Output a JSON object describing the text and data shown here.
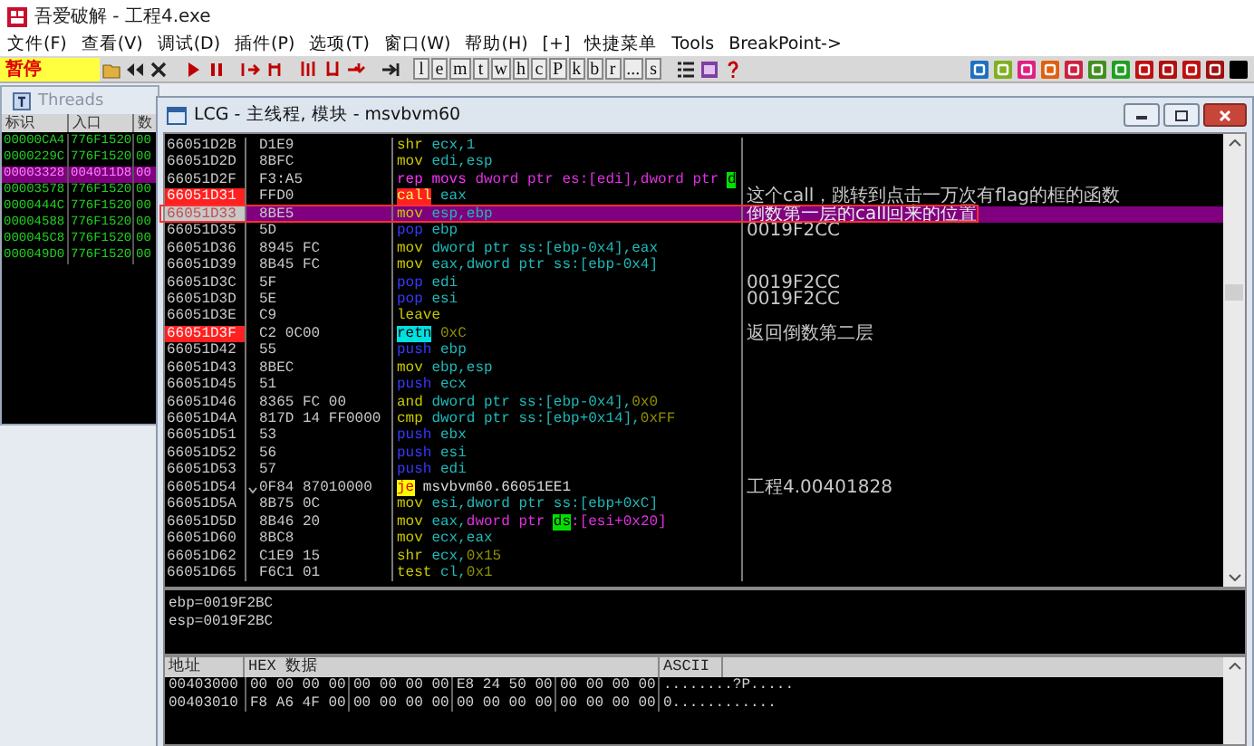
{
  "window": {
    "title": "吾爱破解 - 工程4.exe"
  },
  "menu": [
    "文件(F)",
    "查看(V)",
    "调试(D)",
    "插件(P)",
    "选项(T)",
    "窗口(W)",
    "帮助(H)",
    "[+]",
    "快捷菜单",
    "Tools",
    "BreakPoint->"
  ],
  "toolbar": {
    "status": "暂停",
    "letters": [
      "l",
      "e",
      "m",
      "t",
      "w",
      "h",
      "c",
      "P",
      "k",
      "b",
      "r",
      "...",
      "s"
    ]
  },
  "threads_window": {
    "title": "Threads",
    "columns": [
      "标识",
      "入口",
      "数"
    ],
    "rows": [
      {
        "cells": [
          "00000CA4",
          "776F1520",
          "00"
        ],
        "selected": false
      },
      {
        "cells": [
          "0000229C",
          "776F1520",
          "00"
        ],
        "selected": false
      },
      {
        "cells": [
          "00003328",
          "004011D8",
          "00"
        ],
        "selected": true
      },
      {
        "cells": [
          "00003578",
          "776F1520",
          "00"
        ],
        "selected": false
      },
      {
        "cells": [
          "0000444C",
          "776F1520",
          "00"
        ],
        "selected": false
      },
      {
        "cells": [
          "00004588",
          "776F1520",
          "00"
        ],
        "selected": false
      },
      {
        "cells": [
          "000045C8",
          "776F1520",
          "00"
        ],
        "selected": false
      },
      {
        "cells": [
          "000049D0",
          "776F1520",
          "00"
        ],
        "selected": false
      }
    ]
  },
  "cpu_window": {
    "title": "LCG - 主线程, 模块 - msvbvm60",
    "rows": [
      {
        "address": "66051D2B",
        "hex": "D1E9",
        "mnemonic": "shr",
        "kind": "plain",
        "operands": [
          {
            "text": "ecx,1",
            "kind": "reg"
          }
        ],
        "breakpoint": false,
        "selected": false
      },
      {
        "address": "66051D2D",
        "hex": "8BFC",
        "mnemonic": "mov",
        "kind": "plain",
        "operands": [
          {
            "text": "edi,esp",
            "kind": "reg"
          }
        ],
        "breakpoint": false,
        "selected": false
      },
      {
        "address": "66051D2F",
        "hex": "F3:A5",
        "mnemonic": "rep movs",
        "kind": "string",
        "operands": [
          {
            "text": "dword ptr es:[edi],dword ptr ",
            "kind": "string"
          },
          {
            "text": "d",
            "kind": "segment"
          }
        ],
        "breakpoint": false,
        "selected": false
      },
      {
        "address": "66051D31",
        "hex": "FFD0",
        "mnemonic": "call",
        "kind": "call",
        "operands": [
          {
            "text": "eax",
            "kind": "reg"
          }
        ],
        "comment": "这个call，跳转到点击一万次有flag的框的函数",
        "breakpoint": true,
        "selected": false
      },
      {
        "address": "66051D33",
        "hex": "8BE5",
        "mnemonic": "mov",
        "kind": "plain",
        "operands": [
          {
            "text": "esp,ebp",
            "kind": "reg"
          }
        ],
        "comment": "倒数第一层的call回来的位置",
        "breakpoint": false,
        "selected": true,
        "boxed": true
      },
      {
        "address": "66051D35",
        "hex": "5D",
        "mnemonic": "pop",
        "kind": "stack",
        "operands": [
          {
            "text": "ebp",
            "kind": "reg"
          }
        ],
        "comment": "0019F2CC",
        "breakpoint": false,
        "selected": false
      },
      {
        "address": "66051D36",
        "hex": "8945 FC",
        "mnemonic": "mov",
        "kind": "plain",
        "operands": [
          {
            "text": "dword ptr ss:[ebp-0x4],eax",
            "kind": "reg"
          }
        ],
        "breakpoint": false,
        "selected": false
      },
      {
        "address": "66051D39",
        "hex": "8B45 FC",
        "mnemonic": "mov",
        "kind": "plain",
        "operands": [
          {
            "text": "eax,dword ptr ss:[ebp-0x4]",
            "kind": "reg"
          }
        ],
        "breakpoint": false,
        "selected": false
      },
      {
        "address": "66051D3C",
        "hex": "5F",
        "mnemonic": "pop",
        "kind": "stack",
        "operands": [
          {
            "text": "edi",
            "kind": "reg"
          }
        ],
        "comment": "0019F2CC",
        "breakpoint": false,
        "selected": false
      },
      {
        "address": "66051D3D",
        "hex": "5E",
        "mnemonic": "pop",
        "kind": "stack",
        "operands": [
          {
            "text": "esi",
            "kind": "reg"
          }
        ],
        "comment": "0019F2CC",
        "breakpoint": false,
        "selected": false
      },
      {
        "address": "66051D3E",
        "hex": "C9",
        "mnemonic": "leave",
        "kind": "plain",
        "operands": [],
        "breakpoint": false,
        "selected": false
      },
      {
        "address": "66051D3F",
        "hex": "C2 0C00",
        "mnemonic": "retn",
        "kind": "return",
        "operands": [
          {
            "text": "0xC",
            "kind": "const"
          }
        ],
        "comment": "返回倒数第二层",
        "breakpoint": true,
        "selected": false
      },
      {
        "address": "66051D42",
        "hex": "55",
        "mnemonic": "push",
        "kind": "stack",
        "operands": [
          {
            "text": "ebp",
            "kind": "reg"
          }
        ],
        "breakpoint": false,
        "selected": false
      },
      {
        "address": "66051D43",
        "hex": "8BEC",
        "mnemonic": "mov",
        "kind": "plain",
        "operands": [
          {
            "text": "ebp,esp",
            "kind": "reg"
          }
        ],
        "breakpoint": false,
        "selected": false
      },
      {
        "address": "66051D45",
        "hex": "51",
        "mnemonic": "push",
        "kind": "stack",
        "operands": [
          {
            "text": "ecx",
            "kind": "reg"
          }
        ],
        "breakpoint": false,
        "selected": false
      },
      {
        "address": "66051D46",
        "hex": "8365 FC 00",
        "mnemonic": "and",
        "kind": "plain",
        "operands": [
          {
            "text": "dword ptr ss:[ebp-0x4],",
            "kind": "reg"
          },
          {
            "text": "0x0",
            "kind": "const"
          }
        ],
        "breakpoint": false,
        "selected": false
      },
      {
        "address": "66051D4A",
        "hex": "817D 14 FF0000",
        "mnemonic": "cmp",
        "kind": "plain",
        "operands": [
          {
            "text": "dword ptr ss:[ebp+0x14],",
            "kind": "reg"
          },
          {
            "text": "0xFF",
            "kind": "const"
          }
        ],
        "breakpoint": false,
        "selected": false
      },
      {
        "address": "66051D51",
        "hex": "53",
        "mnemonic": "push",
        "kind": "stack",
        "operands": [
          {
            "text": "ebx",
            "kind": "reg"
          }
        ],
        "breakpoint": false,
        "selected": false
      },
      {
        "address": "66051D52",
        "hex": "56",
        "mnemonic": "push",
        "kind": "stack",
        "operands": [
          {
            "text": "esi",
            "kind": "reg"
          }
        ],
        "breakpoint": false,
        "selected": false
      },
      {
        "address": "66051D53",
        "hex": "57",
        "mnemonic": "push",
        "kind": "stack",
        "operands": [
          {
            "text": "edi",
            "kind": "reg"
          }
        ],
        "breakpoint": false,
        "selected": false
      },
      {
        "address": "66051D54",
        "hex": "0F84 87010000",
        "mnemonic": "je",
        "kind": "jump",
        "operands": [
          {
            "text": "msvbvm60.66051EE1",
            "kind": "target"
          }
        ],
        "comment": "工程4.00401828",
        "breakpoint": false,
        "selected": false,
        "jump_down": true
      },
      {
        "address": "66051D5A",
        "hex": "8B75 0C",
        "mnemonic": "mov",
        "kind": "plain",
        "operands": [
          {
            "text": "esi,dword ptr ss:[ebp+0xC]",
            "kind": "reg"
          }
        ],
        "breakpoint": false,
        "selected": false
      },
      {
        "address": "66051D5D",
        "hex": "8B46 20",
        "mnemonic": "mov",
        "kind": "plain",
        "operands": [
          {
            "text": "eax,",
            "kind": "reg"
          },
          {
            "text": "dword ptr ",
            "kind": "string"
          },
          {
            "text": "ds",
            "kind": "segment"
          },
          {
            "text": ":[esi+0x20]",
            "kind": "string"
          }
        ],
        "breakpoint": false,
        "selected": false
      },
      {
        "address": "66051D60",
        "hex": "8BC8",
        "mnemonic": "mov",
        "kind": "plain",
        "operands": [
          {
            "text": "ecx,eax",
            "kind": "reg"
          }
        ],
        "breakpoint": false,
        "selected": false
      },
      {
        "address": "66051D62",
        "hex": "C1E9 15",
        "mnemonic": "shr",
        "kind": "plain",
        "operands": [
          {
            "text": "ecx,",
            "kind": "reg"
          },
          {
            "text": "0x15",
            "kind": "const"
          }
        ],
        "breakpoint": false,
        "selected": false
      },
      {
        "address": "66051D65",
        "hex": "F6C1 01",
        "mnemonic": "test",
        "kind": "plain",
        "operands": [
          {
            "text": "cl,",
            "kind": "reg"
          },
          {
            "text": "0x1",
            "kind": "const"
          }
        ],
        "breakpoint": false,
        "selected": false
      }
    ],
    "info": [
      "ebp=0019F2BC",
      "esp=0019F2BC"
    ],
    "dump": {
      "columns": [
        "地址",
        "HEX 数据",
        "ASCII"
      ],
      "rows": [
        {
          "address": "00403000",
          "hex": [
            "00 00 00 00",
            "00 00 00 00",
            "E8 24 50 00",
            "00 00 00 00"
          ],
          "ascii": "........?P....."
        },
        {
          "address": "00403010",
          "hex": [
            "F8 A6 4F 00",
            "00 00 00 00",
            "00 00 00 00",
            "00 00 00 00"
          ],
          "ascii": "   0............"
        }
      ]
    }
  }
}
